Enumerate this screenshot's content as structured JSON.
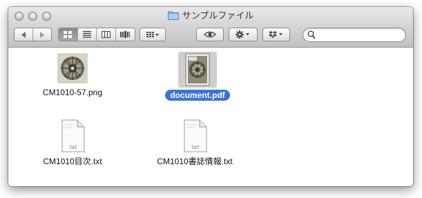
{
  "window": {
    "title": "サンプルファイル"
  },
  "toolbar": {
    "nav": [
      "back",
      "forward"
    ],
    "view_modes": [
      "icon-view",
      "list-view",
      "column-view",
      "cover-flow-view"
    ],
    "active_view": "icon-view",
    "arrange_icon": "arrange-grid-icon",
    "quicklook_icon": "eye-icon",
    "action_icon": "gear-icon",
    "dropbox_icon": "dropbox-icon",
    "search": {
      "value": "",
      "placeholder": ""
    }
  },
  "files": [
    {
      "name": "CM1010-57.png",
      "kind": "image",
      "selected": false
    },
    {
      "name": "document.pdf",
      "kind": "pdf",
      "selected": true
    },
    {
      "name": "CM1010目次.txt",
      "kind": "txt",
      "selected": false,
      "badge": "TXT"
    },
    {
      "name": "CM1010書誌情報.txt",
      "kind": "txt",
      "selected": false,
      "badge": "TXT"
    }
  ],
  "colors": {
    "selection": "#3b74d6",
    "toolbar_top": "#e8e8e8",
    "toolbar_bottom": "#c2c2c2"
  }
}
